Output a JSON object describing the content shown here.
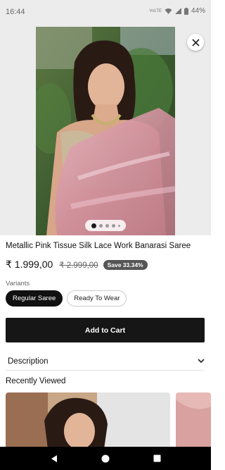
{
  "status_bar": {
    "time": "16:44",
    "network_label": "VoLTE",
    "battery": "44%"
  },
  "gallery": {
    "slide_count": 5,
    "active_slide": 1
  },
  "product": {
    "title": "Metallic Pink Tissue Silk Lace Work Banarasi Saree",
    "price": "₹ 1.999,00",
    "original_price": "₹ 2.999,00",
    "save_badge": "Save 33.34%"
  },
  "variants": {
    "label": "Variants",
    "options": [
      "Regular Saree",
      "Ready To Wear"
    ],
    "selected": "Regular Saree"
  },
  "add_to_cart_label": "Add to Cart",
  "description_label": "Description",
  "recently_viewed_title": "Recently Viewed",
  "colors": {
    "primary": "#161616",
    "saree_pink": "#d99aa6",
    "badge": "#555555"
  }
}
